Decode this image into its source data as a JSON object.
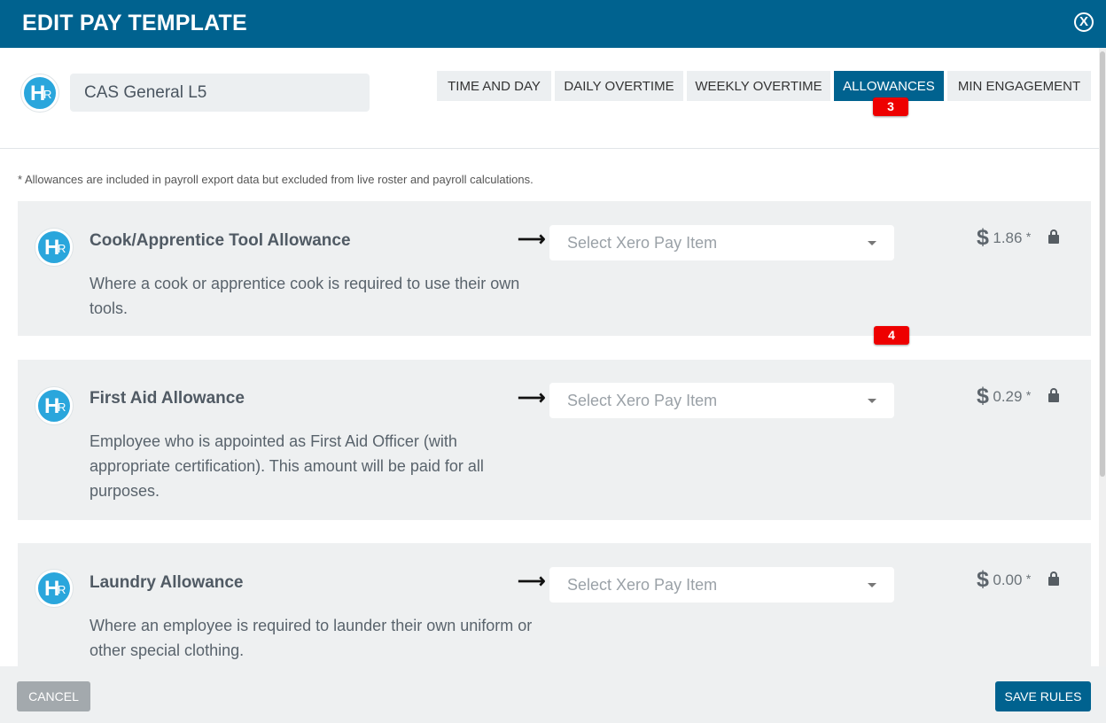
{
  "header": {
    "title": "EDIT PAY TEMPLATE",
    "close_label": "X"
  },
  "logo": {
    "h": "H",
    "r": "R"
  },
  "template": {
    "name": "CAS General L5"
  },
  "tabs": [
    {
      "label": "TIME AND DAY"
    },
    {
      "label": "DAILY OVERTIME"
    },
    {
      "label": "WEEKLY OVERTIME"
    },
    {
      "label": "ALLOWANCES",
      "active": true
    },
    {
      "label": "MIN ENGAGEMENT"
    }
  ],
  "badges": {
    "tab_badge": "3",
    "card_badge": "4"
  },
  "note": "* Allowances are included in payroll export data but excluded from live roster and payroll calculations.",
  "allowances": [
    {
      "title": "Cook/Apprentice Tool Allowance",
      "description": "Where a cook or apprentice cook is required to use their own tools.",
      "select_placeholder": "Select Xero Pay Item",
      "currency": "$",
      "amount": "1.86",
      "asterisk": "*"
    },
    {
      "title": "First Aid Allowance",
      "description": "Employee who is appointed as First Aid Officer (with appropriate certification). This amount will be paid for all purposes.",
      "select_placeholder": "Select Xero Pay Item",
      "currency": "$",
      "amount": "0.29",
      "asterisk": "*"
    },
    {
      "title": "Laundry Allowance",
      "description": "Where an employee is required to launder their own uniform or other special clothing.",
      "select_placeholder": "Select Xero Pay Item",
      "currency": "$",
      "amount": "0.00",
      "asterisk": "*"
    }
  ],
  "arrow_glyph": "⟶",
  "footer": {
    "cancel_label": "CANCEL",
    "save_label": "SAVE RULES"
  },
  "colors": {
    "primary": "#00628f",
    "logo": "#2aa6dc",
    "badge": "#ee0000"
  }
}
